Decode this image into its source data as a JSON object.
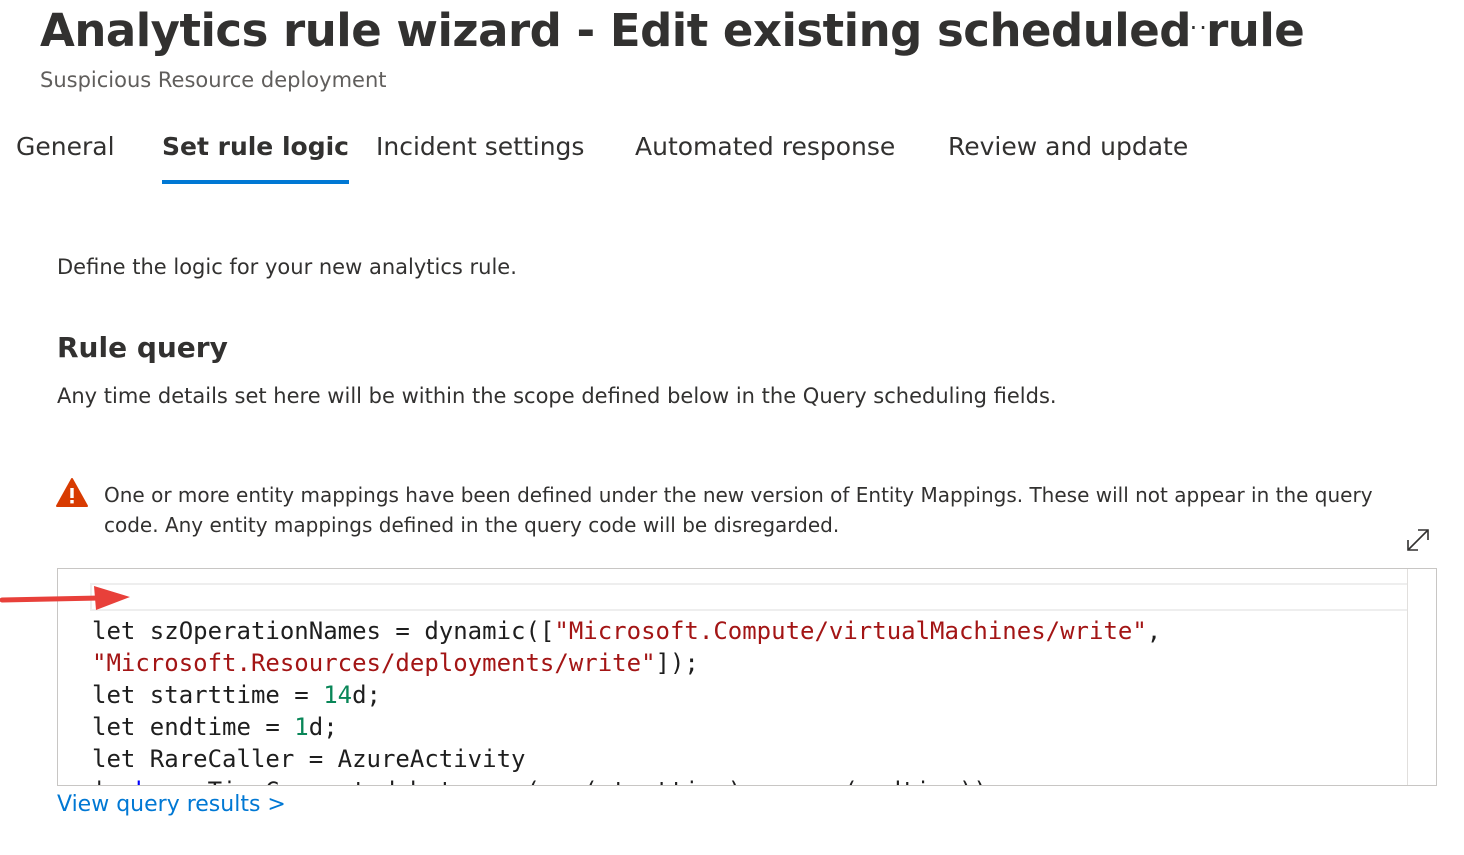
{
  "header": {
    "title": "Analytics rule wizard - Edit existing scheduled rule",
    "more_label": "···",
    "subtitle": "Suspicious Resource deployment"
  },
  "tabs": [
    {
      "label": "General",
      "active": false
    },
    {
      "label": "Set rule logic",
      "active": true
    },
    {
      "label": "Incident settings",
      "active": false
    },
    {
      "label": "Automated response",
      "active": false
    },
    {
      "label": "Review and update",
      "active": false
    }
  ],
  "main": {
    "intro": "Define the logic for your new analytics rule.",
    "section_title": "Rule query",
    "section_desc": "Any time details set here will be within the scope defined below in the Query scheduling fields.",
    "warning": "One or more entity mappings have been defined under the new version of Entity Mappings. These will not appear in the query code. Any entity mappings defined in the query code will be disregarded.",
    "code": {
      "line1_a": "let szOperationNames = dynamic([",
      "line1_b": "\"Microsoft.Compute/virtualMachines/write\"",
      "line1_c": ",",
      "line2_a": "\"Microsoft.Resources/deployments/write\"",
      "line2_b": "]);",
      "line3_a": "let starttime = ",
      "line3_b": "14",
      "line3_c": "d;",
      "line4_a": "let endtime = ",
      "line4_b": "1",
      "line4_c": "d;",
      "line5": "let RareCaller = AzureActivity",
      "line6_a": "| ",
      "line6_b": "where",
      "line6_c": " TimeGenerated between (ago(starttime) .. ago(endtime))"
    },
    "link": "View query results >"
  },
  "colors": {
    "accent": "#0078d4",
    "warning": "#d83b01",
    "arrow": "#e8403a",
    "string": "#a31515",
    "number": "#098658"
  }
}
